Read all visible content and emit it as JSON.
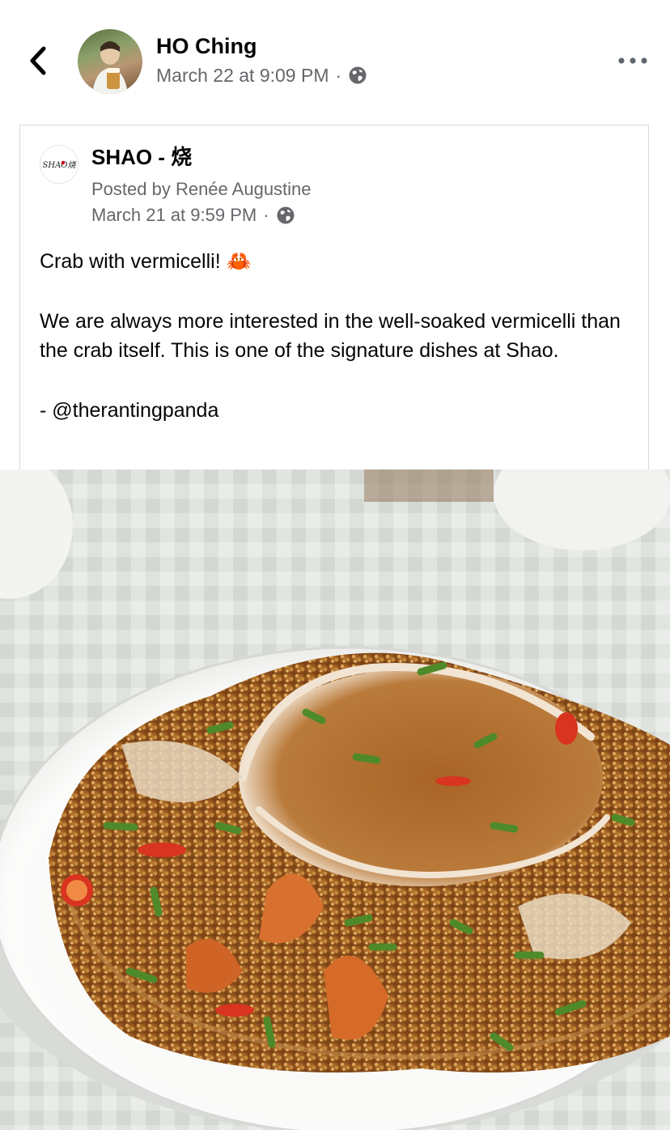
{
  "post": {
    "author_name": "HO Ching",
    "timestamp": "March 22 at 9:09 PM",
    "separator": "·",
    "privacy_icon": "globe-icon"
  },
  "nav": {
    "back_icon": "chevron-left-icon",
    "more_icon": "more-dots-icon"
  },
  "shared_post": {
    "page_name": "SHAO - 烧",
    "page_logo_text": "SHAO烧",
    "posted_by": "Posted by Renée Augustine",
    "timestamp": "March 21 at 9:59 PM",
    "separator": "·",
    "privacy_icon": "globe-icon",
    "text_line1": "Crab with vermicelli! 🦀",
    "text_para2": "We are always more interested in the well-soaked vermicelli than the crab itself. This is one of the signature dishes at Shao.",
    "text_credit": "- @therantingpanda"
  },
  "photo": {
    "subject": "crab-with-vermicelli-dish"
  }
}
